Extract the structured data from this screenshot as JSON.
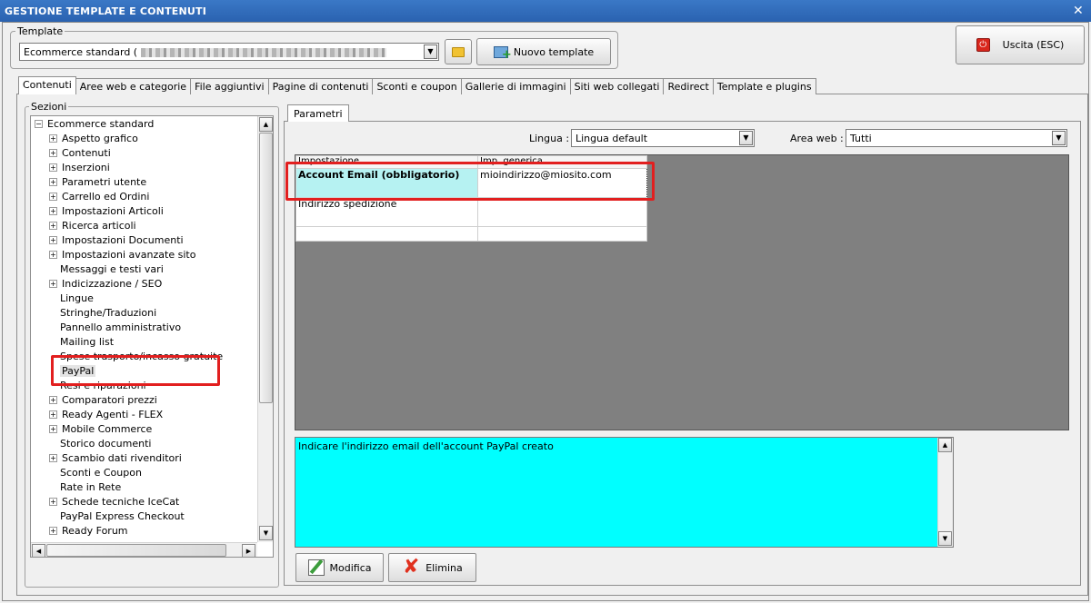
{
  "window": {
    "title": "GESTIONE TEMPLATE E CONTENUTI",
    "close_glyph": "✕"
  },
  "template": {
    "legend": "Template",
    "selected": "Ecommerce standard (",
    "new_button": "Nuovo template"
  },
  "exit_button": "Uscita (ESC)",
  "tabs": [
    "Contenuti",
    "Aree web e categorie",
    "File aggiuntivi",
    "Pagine di contenuti",
    "Sconti e coupon",
    "Gallerie di immagini",
    "Siti web collegati",
    "Redirect",
    "Template e plugins"
  ],
  "sections": {
    "legend": "Sezioni",
    "root": "Ecommerce standard",
    "items": [
      {
        "label": "Aspetto grafico",
        "expandable": true
      },
      {
        "label": "Contenuti",
        "expandable": true
      },
      {
        "label": "Inserzioni",
        "expandable": true
      },
      {
        "label": "Parametri utente",
        "expandable": true
      },
      {
        "label": "Carrello ed Ordini",
        "expandable": true
      },
      {
        "label": "Impostazioni Articoli",
        "expandable": true
      },
      {
        "label": "Ricerca articoli",
        "expandable": true
      },
      {
        "label": "Impostazioni Documenti",
        "expandable": true
      },
      {
        "label": "Impostazioni avanzate sito",
        "expandable": true
      },
      {
        "label": "Messaggi e testi vari",
        "expandable": false
      },
      {
        "label": "Indicizzazione / SEO",
        "expandable": true
      },
      {
        "label": "Lingue",
        "expandable": false
      },
      {
        "label": "Stringhe/Traduzioni",
        "expandable": false
      },
      {
        "label": "Pannello amministrativo",
        "expandable": false
      },
      {
        "label": "Mailing list",
        "expandable": false
      },
      {
        "label": "Spese trasporto/incasso gratuite",
        "expandable": false
      },
      {
        "label": "PayPal",
        "expandable": false,
        "selected": true
      },
      {
        "label": "Resi e riparazioni",
        "expandable": false
      },
      {
        "label": "Comparatori prezzi",
        "expandable": true
      },
      {
        "label": "Ready Agenti - FLEX",
        "expandable": true
      },
      {
        "label": "Mobile Commerce",
        "expandable": true
      },
      {
        "label": "Storico documenti",
        "expandable": false
      },
      {
        "label": "Scambio dati rivenditori",
        "expandable": true
      },
      {
        "label": "Sconti e Coupon",
        "expandable": false
      },
      {
        "label": "Rate in Rete",
        "expandable": false
      },
      {
        "label": "Schede tecniche IceCat",
        "expandable": true
      },
      {
        "label": "PayPal Express Checkout",
        "expandable": false
      },
      {
        "label": "Ready Forum",
        "expandable": true
      }
    ]
  },
  "params": {
    "tab": "Parametri",
    "language_label": "Lingua :",
    "language_value": "Lingua default",
    "area_label": "Area web :",
    "area_value": "Tutti",
    "columns": [
      "Impostazione",
      "Imp. generica"
    ],
    "rows": [
      {
        "key": "Account Email (obbligatorio)",
        "value": "mioindirizzo@miosito.com"
      },
      {
        "key": "Indirizzo spedizione",
        "value": ""
      },
      {
        "key": "",
        "value": ""
      }
    ],
    "description": "Indicare l'indirizzo email dell'account PayPal creato"
  },
  "actions": {
    "edit": "Modifica",
    "delete": "Elimina"
  },
  "colors": {
    "title_bar": "#2a62b0",
    "highlight": "#e21f1f",
    "description_bg": "#00ffff",
    "selected_key_bg": "#b6f2f2"
  }
}
